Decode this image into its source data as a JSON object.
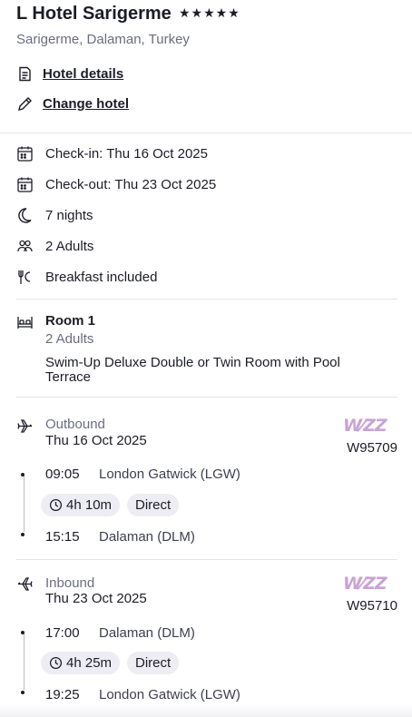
{
  "hotel": {
    "name": "L Hotel Sarigerme",
    "stars": "★★★★★",
    "location": "Sarigerme, Dalaman, Turkey",
    "details_link": "Hotel details",
    "change_link": "Change hotel"
  },
  "stay": {
    "check_in": "Check-in: Thu 16 Oct 2025",
    "check_out": "Check-out: Thu 23 Oct 2025",
    "nights": "7 nights",
    "guests": "2 Adults",
    "board": "Breakfast included"
  },
  "room": {
    "title": "Room 1",
    "guests": "2 Adults",
    "description": "Swim-Up Deluxe Double or Twin Room with Pool Terrace"
  },
  "flights": {
    "outbound": {
      "label": "Outbound",
      "date": "Thu 16 Oct 2025",
      "airline_logo": "W⁄ZZ",
      "flight_number": "W95709",
      "depart_time": "09:05",
      "depart_airport": "London Gatwick (LGW)",
      "duration": "4h 10m",
      "stops": "Direct",
      "arrive_time": "15:15",
      "arrive_airport": "Dalaman (DLM)"
    },
    "inbound": {
      "label": "Inbound",
      "date": "Thu 23 Oct 2025",
      "airline_logo": "W⁄ZZ",
      "flight_number": "W95710",
      "depart_time": "17:00",
      "depart_airport": "Dalaman (DLM)",
      "duration": "4h 25m",
      "stops": "Direct",
      "arrive_time": "19:25",
      "arrive_airport": "London Gatwick (LGW)"
    }
  },
  "colors": {
    "text": "#1c1c28",
    "muted": "#6b6c85",
    "chip": "#ededf3",
    "airline_brand": "#c9a2d6"
  }
}
